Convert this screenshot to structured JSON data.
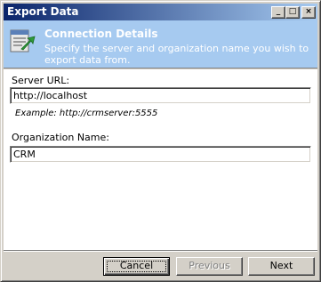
{
  "window": {
    "title": "Export Data",
    "minimize_glyph": "_",
    "maximize_glyph": "□",
    "close_glyph": "×"
  },
  "header": {
    "title": "Connection Details",
    "description": "Specify the server and organization name you wish to export data from.",
    "icon": "export-wizard-icon",
    "background_color": "#a6caf0"
  },
  "form": {
    "server_label": "Server URL:",
    "server_value": "http://localhost",
    "server_example": "Example: http://crmserver:5555",
    "org_label": "Organization Name:",
    "org_value": "CRM"
  },
  "buttons": {
    "cancel": "Cancel",
    "previous": "Previous",
    "next": "Next"
  },
  "colors": {
    "title_bar_start": "#0a246a",
    "title_bar_end": "#a6caf0",
    "dialog_face": "#d4d0c8"
  }
}
